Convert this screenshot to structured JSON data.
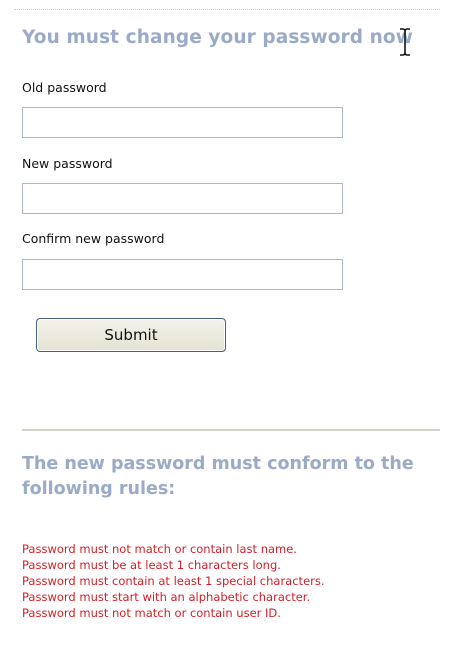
{
  "form": {
    "title": "You must change your password now",
    "fields": [
      {
        "label": "Old password",
        "value": ""
      },
      {
        "label": "New password",
        "value": ""
      },
      {
        "label": "Confirm new password",
        "value": ""
      }
    ],
    "submit_label": "Submit"
  },
  "rules": {
    "heading": "The new password must conform to the following rules:",
    "items": [
      "Password must not match or contain last name.",
      "Password must be at least 1 characters long.",
      "Password must contain at least 1 special characters.",
      "Password must start with an alphabetic character.",
      "Password must not match or contain user ID."
    ]
  },
  "colors": {
    "heading": "#9aaac7",
    "rule_text": "#d21f28",
    "input_border": "#a9b7c9",
    "divider": "#d3d2c8"
  },
  "icons": {
    "cursor": "i-beam-cursor-icon"
  }
}
